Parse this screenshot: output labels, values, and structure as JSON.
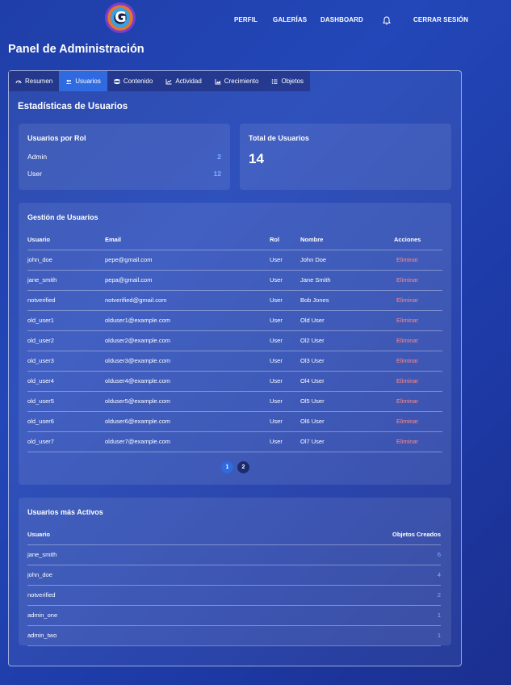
{
  "nav": {
    "perfil": "PERFIL",
    "galerias": "GALERÍAS",
    "dashboard": "DASHBOARD",
    "logout": "CERRAR SESIÓN"
  },
  "page_title": "Panel de Administración",
  "tabs": [
    {
      "label": "Resumen",
      "icon": "gauge-icon"
    },
    {
      "label": "Usuarios",
      "icon": "users-icon",
      "active": true
    },
    {
      "label": "Contenido",
      "icon": "database-icon"
    },
    {
      "label": "Actividad",
      "icon": "chart-line-icon"
    },
    {
      "label": "Crecimiento",
      "icon": "chart-area-icon"
    },
    {
      "label": "Objetos",
      "icon": "list-icon"
    }
  ],
  "stats": {
    "title": "Estadísticas de Usuarios",
    "roles_card": {
      "title": "Usuarios por Rol",
      "rows": [
        {
          "label": "Admin",
          "value": "2"
        },
        {
          "label": "User",
          "value": "12"
        }
      ]
    },
    "total_card": {
      "title": "Total de Usuarios",
      "value": "14"
    }
  },
  "management": {
    "title": "Gestión de Usuarios",
    "columns": [
      "Usuario",
      "Email",
      "Rol",
      "Nombre",
      "Acciones"
    ],
    "rows": [
      {
        "usuario": "john_doe",
        "email": "pepe@gmail.com",
        "rol": "User",
        "nombre": "John Doe",
        "accion": "Eliminar"
      },
      {
        "usuario": "jane_smith",
        "email": "pepa@gmail.com",
        "rol": "User",
        "nombre": "Jane Smith",
        "accion": "Eliminar"
      },
      {
        "usuario": "notverified",
        "email": "notverified@gmail.com",
        "rol": "User",
        "nombre": "Bob Jones",
        "accion": "Eliminar"
      },
      {
        "usuario": "old_user1",
        "email": "olduser1@example.com",
        "rol": "User",
        "nombre": "Old User",
        "accion": "Eliminar"
      },
      {
        "usuario": "old_user2",
        "email": "olduser2@example.com",
        "rol": "User",
        "nombre": "Ol2 User",
        "accion": "Eliminar"
      },
      {
        "usuario": "old_user3",
        "email": "olduser3@example.com",
        "rol": "User",
        "nombre": "Ol3 User",
        "accion": "Eliminar"
      },
      {
        "usuario": "old_user4",
        "email": "olduser4@example.com",
        "rol": "User",
        "nombre": "Ol4 User",
        "accion": "Eliminar"
      },
      {
        "usuario": "old_user5",
        "email": "olduser5@example.com",
        "rol": "User",
        "nombre": "Ol5 User",
        "accion": "Eliminar"
      },
      {
        "usuario": "old_user6",
        "email": "olduser6@example.com",
        "rol": "User",
        "nombre": "Ol6 User",
        "accion": "Eliminar"
      },
      {
        "usuario": "old_user7",
        "email": "olduser7@example.com",
        "rol": "User",
        "nombre": "Ol7 User",
        "accion": "Eliminar"
      }
    ],
    "pagination": {
      "pages": [
        "1",
        "2"
      ],
      "current": "1"
    }
  },
  "active_users": {
    "title": "Usuarios más Activos",
    "columns": [
      "Usuario",
      "Objetos Creados"
    ],
    "rows": [
      {
        "usuario": "jane_smith",
        "count": "6"
      },
      {
        "usuario": "john_doe",
        "count": "4"
      },
      {
        "usuario": "notverified",
        "count": "2"
      },
      {
        "usuario": "admin_one",
        "count": "1"
      },
      {
        "usuario": "admin_two",
        "count": "1"
      }
    ]
  },
  "colors": {
    "accent": "#2f6ae0",
    "value_blue": "#7fb2ff",
    "danger": "#ff8a8a"
  }
}
